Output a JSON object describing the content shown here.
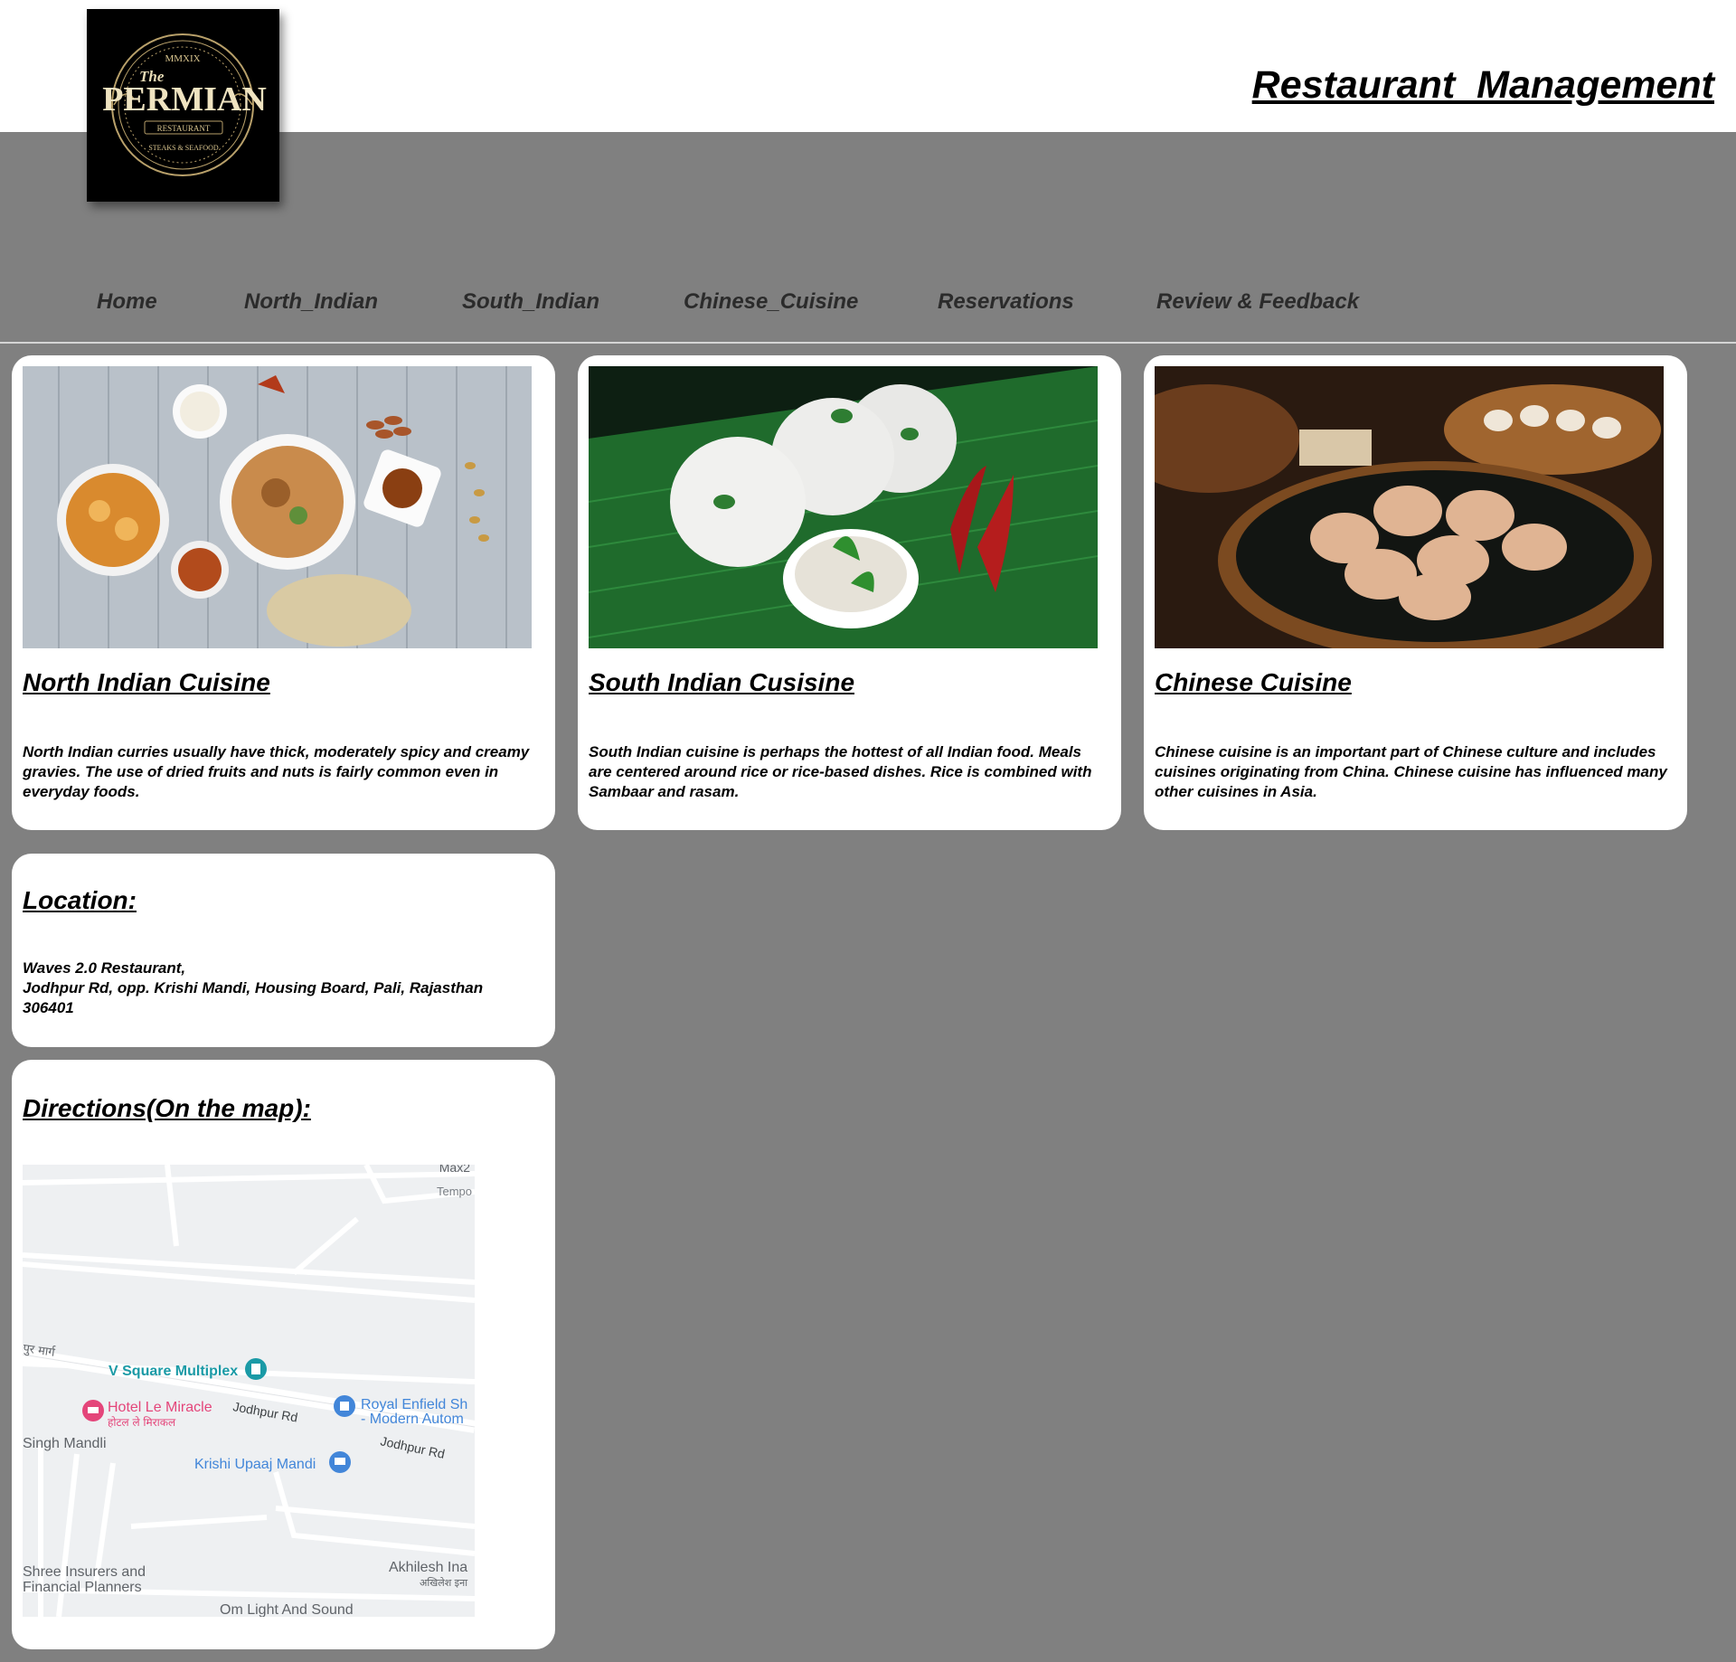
{
  "header": {
    "logo": {
      "roman_numeral": "MMXIX",
      "the": "The",
      "name": "PERMIAN",
      "ribbon": "RESTAURANT",
      "tagline": "STEAKS & SEAFOOD"
    },
    "site_title": "Restaurant  Management"
  },
  "nav": {
    "items": [
      {
        "label": "Home"
      },
      {
        "label": "North_Indian"
      },
      {
        "label": "South_Indian"
      },
      {
        "label": "Chinese_Cuisine"
      },
      {
        "label": "Reservations"
      },
      {
        "label": "Review & Feedback"
      }
    ]
  },
  "cards": [
    {
      "image": "north-indian-food-photo",
      "title": "North Indian Cuisine",
      "description": "North Indian curries usually have thick, moderately spicy and creamy gravies. The use of dried fruits and nuts is fairly common even in everyday foods."
    },
    {
      "image": "south-indian-food-photo",
      "title": "South Indian Cusisine",
      "description": "South Indian cuisine is perhaps the hottest of all Indian food. Meals are centered around rice or rice-based dishes. Rice is combined with Sambaar and rasam."
    },
    {
      "image": "chinese-food-photo",
      "title": "Chinese Cuisine",
      "description": "Chinese cuisine is an important part of Chinese culture and includes cuisines originating from China. Chinese cuisine has influenced many other cuisines in Asia."
    }
  ],
  "location": {
    "title": "Location:",
    "line1": "Waves 2.0 Restaurant,",
    "line2": "Jodhpur Rd, opp. Krishi Mandi, Housing Board, Pali, Rajasthan",
    "line3": "306401"
  },
  "directions": {
    "title": "Directions(On the map):",
    "map_labels": {
      "max": "Max2",
      "tempo": "Tempo",
      "hindi_marg": "पुर मार्ग",
      "v_square": "V Square Multiplex",
      "hotel": "Hotel Le Miracle",
      "hotel_hindi": "होटल ले मिराकल",
      "jodhpur_rd_1": "Jodhpur Rd",
      "royal_enfield_1": "Royal Enfield Sh",
      "royal_enfield_2": "- Modern Autom",
      "singh_mandli": "Singh Mandli",
      "jodhpur_rd_2": "Jodhpur Rd",
      "krishi": "Krishi Upaaj Mandi",
      "shree_1": "Shree Insurers and",
      "shree_2": "Financial Planners",
      "akhilesh": "Akhilesh Ina",
      "akhilesh_hindi": "अखिलेश इना",
      "om_light": "Om Light And Sound"
    },
    "map_colors": {
      "v_square": "#1a9aa6",
      "hotel": "#e4457a",
      "blue_pois": "#4286d9",
      "text": "#5f6368"
    }
  },
  "colors": {
    "page_bg": "#808080",
    "header_bg": "#ffffff",
    "card_bg": "#ffffff",
    "nav_text": "#2b2b2b"
  }
}
